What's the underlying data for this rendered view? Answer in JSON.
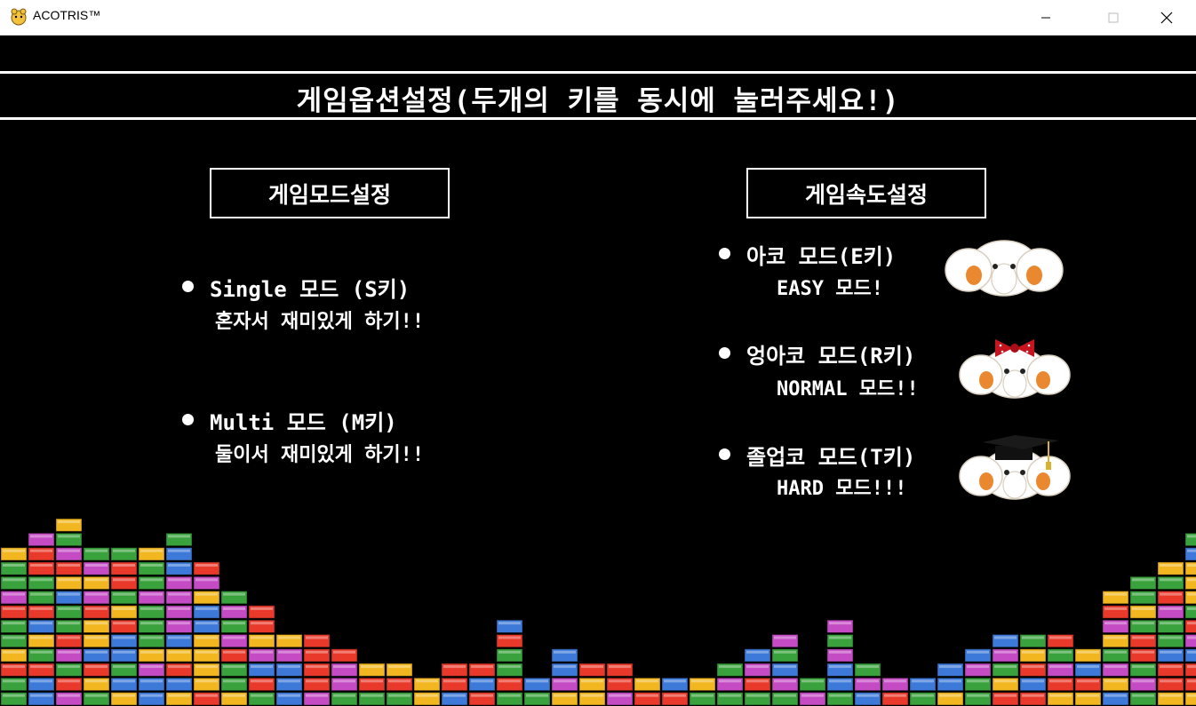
{
  "window": {
    "title": "ACOTRIS™",
    "minimize_icon": "minimize-icon",
    "maximize_icon": "maximize-icon",
    "close_icon": "close-icon"
  },
  "header": {
    "title": "게임옵션설정(두개의 키를 동시에 눌러주세요!)"
  },
  "game_mode": {
    "heading": "게임모드설정",
    "options": [
      {
        "label": "Single 모드 (S키)",
        "description": "혼자서 재미있게 하기!!"
      },
      {
        "label": "Multi 모드 (M키)",
        "description": "둘이서 재미있게 하기!!"
      }
    ]
  },
  "game_speed": {
    "heading": "게임속도설정",
    "options": [
      {
        "label": "아코 모드(E키)",
        "description": "EASY 모드!",
        "icon": "elephant-icon"
      },
      {
        "label": "엉아코 모드(R키)",
        "description": "NORMAL 모드!!",
        "icon": "elephant-bow-icon"
      },
      {
        "label": "졸업코 모드(T키)",
        "description": "HARD 모드!!!",
        "icon": "elephant-graduate-icon"
      }
    ]
  },
  "colors": {
    "background": "#000000",
    "text": "#ffffff",
    "bricks": [
      "#e8392a",
      "#f2b720",
      "#3aa23c",
      "#3d79d8",
      "#c44bc4"
    ]
  },
  "decoration": {
    "bottom": "tetris-brick-wall"
  }
}
